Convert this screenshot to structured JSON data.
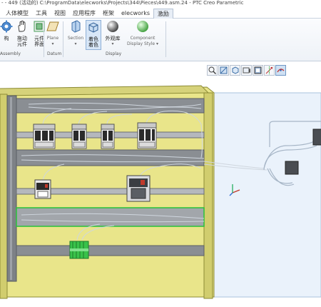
{
  "window": {
    "title": "- - 449 (活动的) C:\\ProgramData\\elecworks\\Projects\\344\\Pieces\\449.asm.24  - PTC Creo Parametric"
  },
  "menu_tabs": [
    "人体模型",
    "工具",
    "视图",
    "应用程序",
    "框架",
    "elecworks",
    "激励"
  ],
  "ribbon": {
    "buttons": [
      {
        "label": "构",
        "label2": ""
      },
      {
        "label": "拖动",
        "label2": "元件"
      },
      {
        "label": "元件",
        "label2": "界面"
      },
      {
        "label": "Plane",
        "label2": "▾"
      },
      {
        "label": "Section",
        "label2": "▾"
      },
      {
        "label": "着色",
        "label2": "着色"
      },
      {
        "label": "外观库",
        "label2": "▾"
      },
      {
        "label": "Component",
        "label2": "Display Style ▾"
      }
    ],
    "groups": [
      "Assembly",
      "Datum",
      "Display"
    ]
  },
  "view_toolbar": {
    "icons": [
      "zoom-icon",
      "refit-icon",
      "orient-icon",
      "named-view-icon",
      "display-style-icon",
      "datum-display-icon",
      "spin-center-icon"
    ]
  },
  "colors": {
    "panel_fill": "#e9e58a",
    "panel_frame": "#9a9a3c",
    "din_rail": "#b5b8bd",
    "wire_duct": "#7d8186",
    "background_plane": "#eaf2fb",
    "selection_green": "#29c23a"
  }
}
